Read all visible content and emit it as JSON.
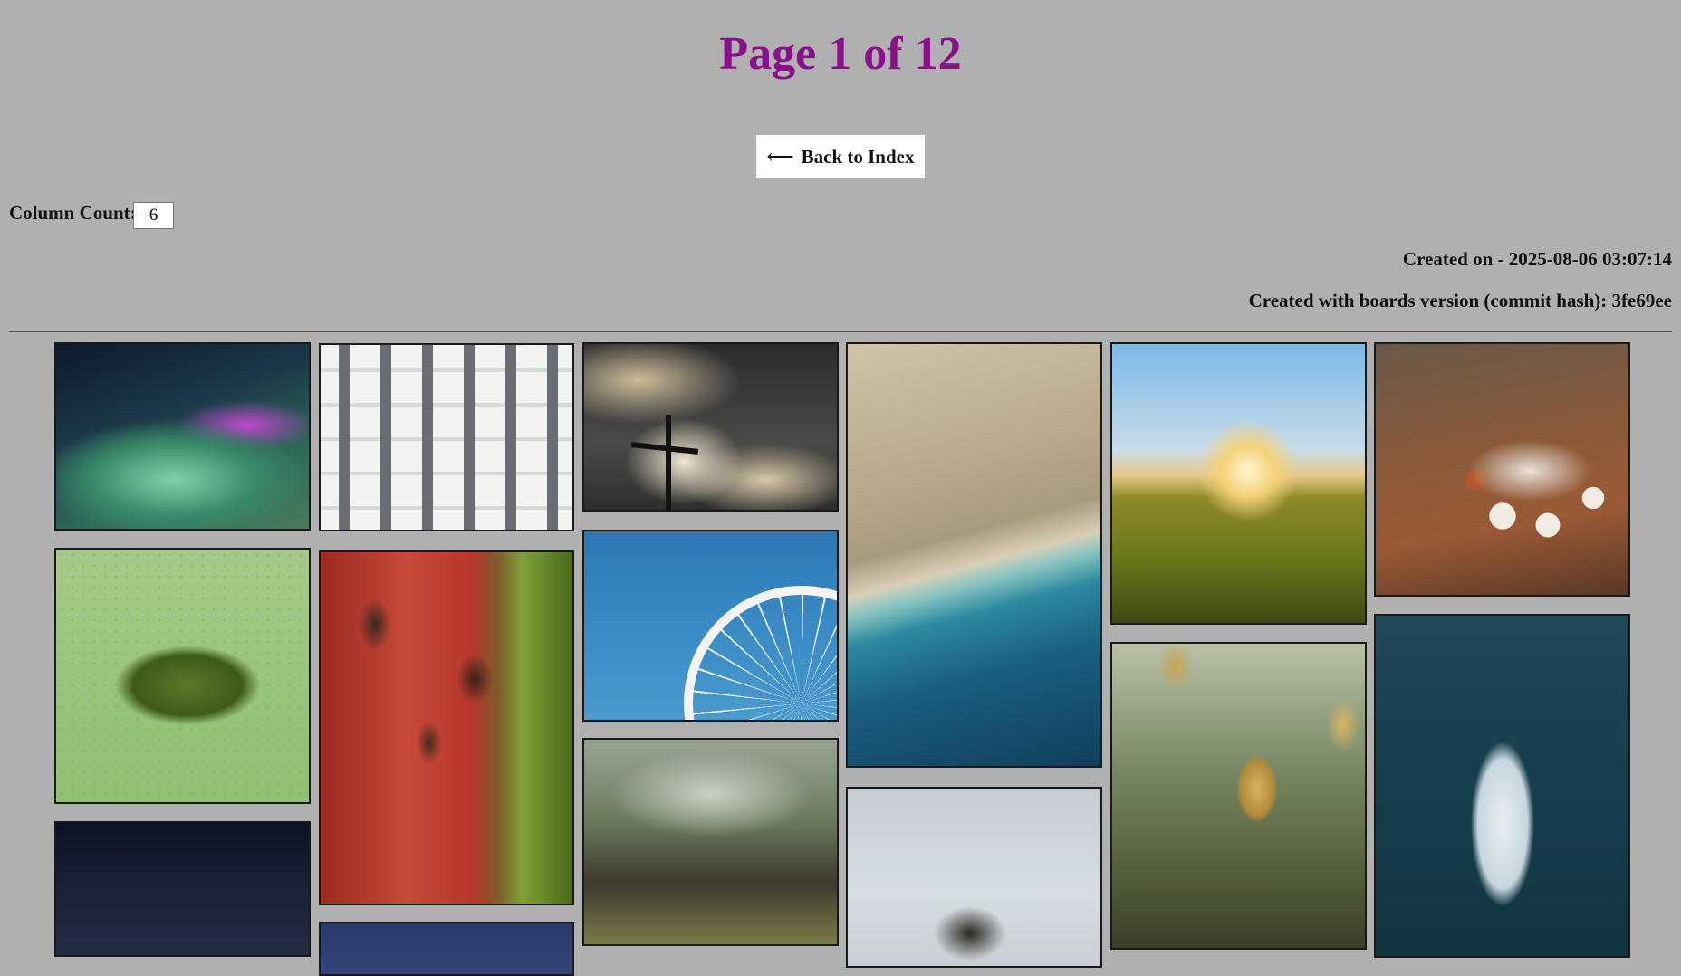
{
  "page": {
    "title": "Page 1 of 12",
    "back_button": {
      "arrow": "⟵",
      "label": "Back to Index"
    },
    "column_count": {
      "label": "Column Count:",
      "value": "6"
    },
    "created_on": "Created on - 2025-08-06 03:07:14",
    "created_with": "Created with boards version (commit hash): 3fe69ee"
  },
  "gallery": {
    "tiles": [
      {
        "subject": "earth-aurora-space-station"
      },
      {
        "subject": "white-apartment-building"
      },
      {
        "subject": "cross-against-clouds"
      },
      {
        "subject": "aerial-coastline"
      },
      {
        "subject": "sunrise-meadow-trees"
      },
      {
        "subject": "enamel-mugs-on-table"
      },
      {
        "subject": "frog-in-duckweed"
      },
      {
        "subject": "rusty-red-barrel-in-grass"
      },
      {
        "subject": "ferris-wheel-blue-sky"
      },
      {
        "subject": "blurred-forest-path"
      },
      {
        "subject": "hazy-sky-silhouette"
      },
      {
        "subject": "autumn-leaves-branch"
      },
      {
        "subject": "aerial-couple-on-boat"
      },
      {
        "subject": "night-sky"
      },
      {
        "subject": "blue-sky"
      }
    ]
  }
}
